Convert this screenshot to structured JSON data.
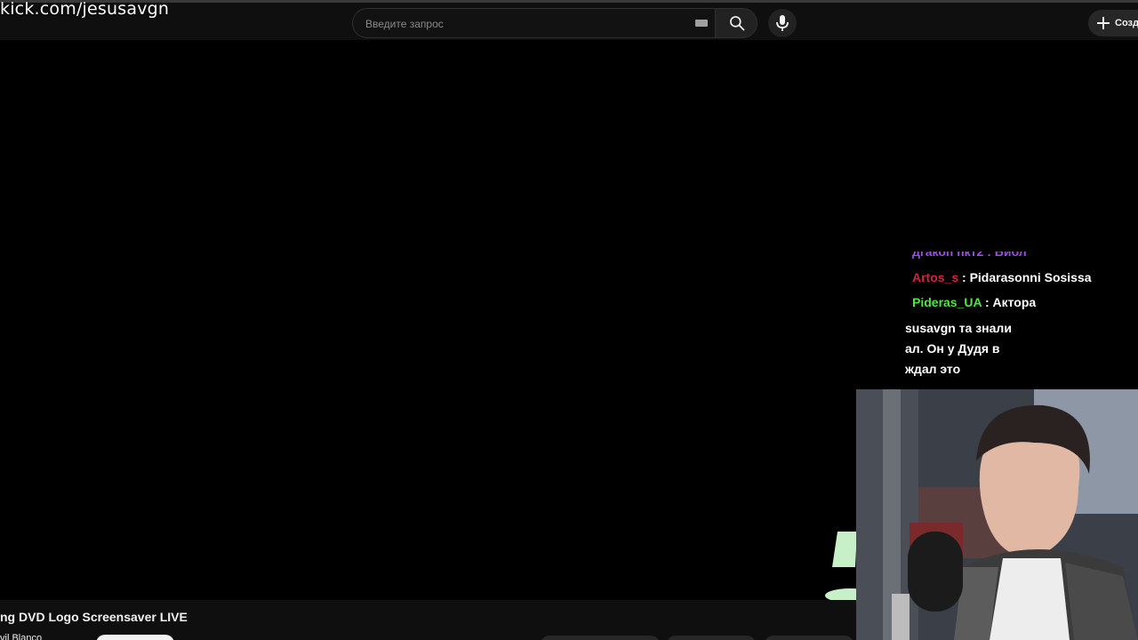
{
  "overlay": {
    "url_text": "kick.com/jesusavgn"
  },
  "header": {
    "search": {
      "placeholder": "Введите запрос",
      "value": ""
    },
    "create_label": "Созд"
  },
  "chat": {
    "top_cut_text": "дгакоп пкт2 : Библ",
    "messages": [
      {
        "user": "Artos_s",
        "text": " : Pidarasonni Sosissa",
        "color": "#d4213d"
      },
      {
        "user": "Pideras_UA",
        "text": " : Актора",
        "color": "#54e346"
      }
    ],
    "fragment_lines": [
      "susavgn та знали",
      "ал. Он у Дудя в",
      "ждал это"
    ]
  },
  "video_info": {
    "title": "ng DVD Logo Screensaver LIVE",
    "channel": "vil Blanco"
  },
  "colors": {
    "background": "#0f0f0f",
    "video_bg": "#000000",
    "top_cut_user": "#9b4ee6",
    "dvd_logo": "#c8f0c8"
  },
  "icons": [
    "keyboard-icon",
    "search-icon",
    "mic-icon",
    "plus-icon",
    "dvd-logo"
  ]
}
